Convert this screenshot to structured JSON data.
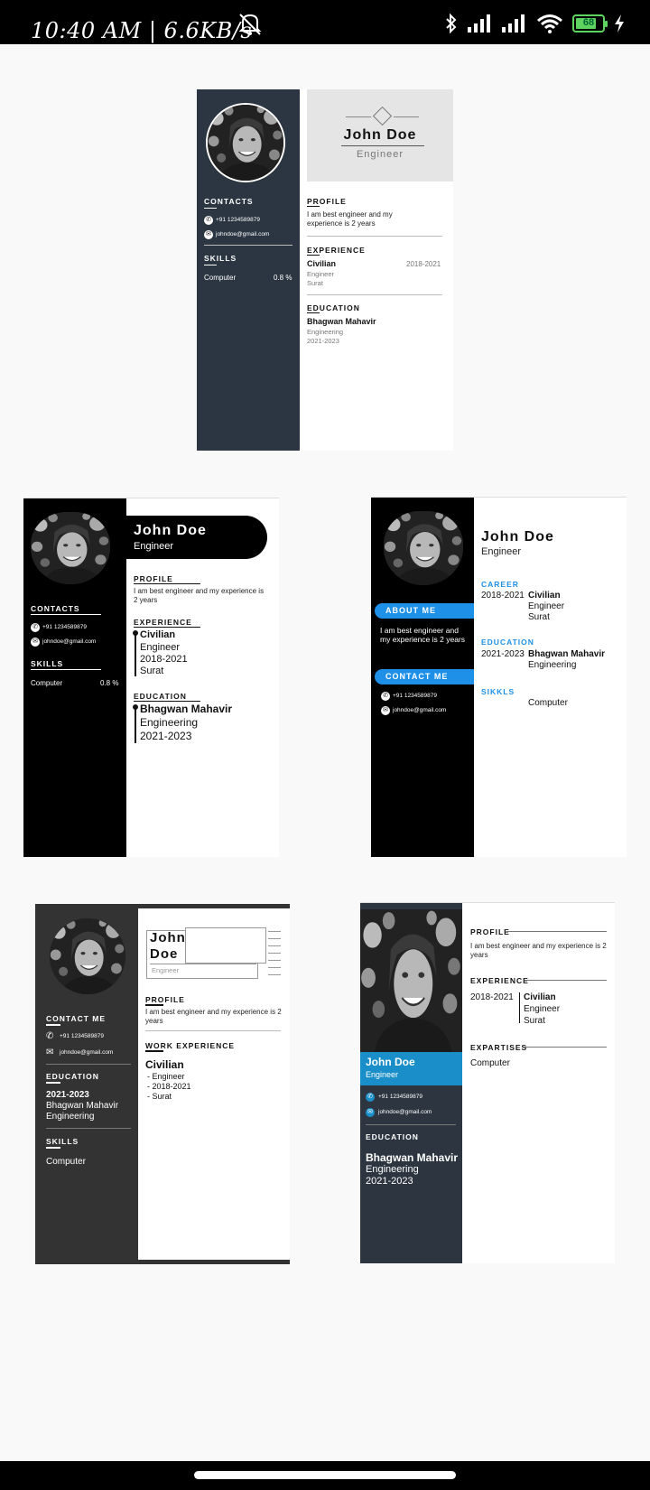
{
  "status": {
    "time_speed": "10:40 AM | 6.6KB/s",
    "battery": "68",
    "colors": {
      "bar": "#000000",
      "battery": "#5fd35f"
    },
    "icons": [
      "mute-icon",
      "bluetooth-icon",
      "signal-icon",
      "signal-icon",
      "wifi-icon",
      "battery-icon",
      "charging-icon"
    ]
  },
  "resume": {
    "name": "John Doe",
    "first": "John",
    "last": "Doe",
    "role": "Engineer",
    "phone": "+91 1234589879",
    "email": "johndoe@gmail.com",
    "skill": "Computer",
    "skill_value": "0.8 %",
    "profile_text": "I am best engineer and my experience is 2 years",
    "exp_company": "Civilian",
    "exp_role": "Engineer",
    "exp_years": "2018-2021",
    "exp_city": "Surat",
    "edu_school": "Bhagwan Mahavir",
    "edu_field": "Engineering",
    "edu_years": "2021-2023",
    "dash_role": "- Engineer",
    "dash_years": "- 2018-2021",
    "dash_city": "- Surat"
  },
  "t1": {
    "contacts": "CONTACTS",
    "skills": "SKILLS",
    "profile": "PROFILE",
    "experience": "EXPERIENCE",
    "education": "EDUCATION"
  },
  "t2": {
    "contacts": "CONTACTS",
    "skills": "SKILLS",
    "profile": "PROFILE",
    "experience": "EXPERIENCE",
    "education": "EDUCATION"
  },
  "t3": {
    "about": "ABOUT ME",
    "contact": "CONTACT ME",
    "career": "CAREER",
    "education": "EDUCATION",
    "skills": "SIKKLS",
    "accent": "#1e90e8"
  },
  "t4": {
    "contact": "CONTACT ME",
    "education": "EDUCATION",
    "skills": "SKILLS",
    "profile": "PROFILE",
    "work": "WORK EXPERIENCE"
  },
  "t5": {
    "profile": "PROFILE",
    "experience": "EXPERIENCE",
    "expertises": "EXPARTISES",
    "education": "EDUCATION",
    "accent": "#1a8ec8"
  }
}
